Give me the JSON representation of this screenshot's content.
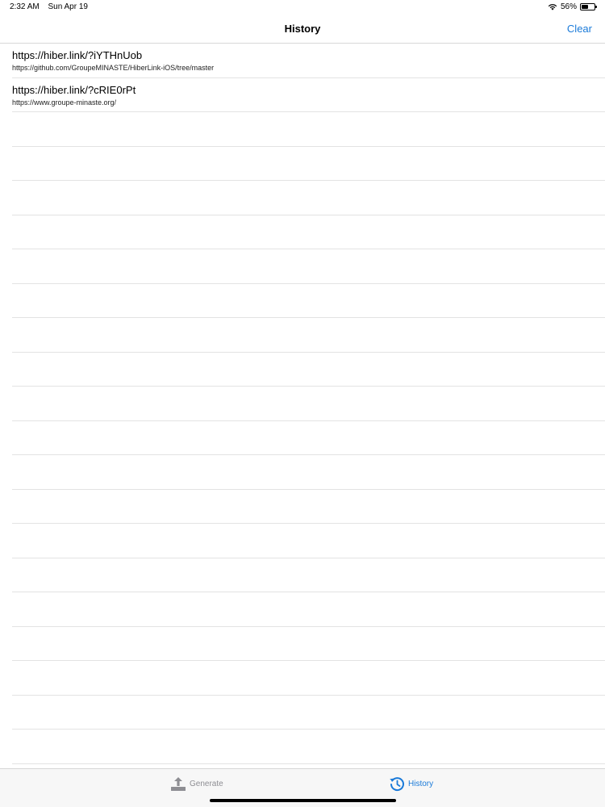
{
  "status_bar": {
    "time": "2:32 AM",
    "date": "Sun Apr 19",
    "battery": "56%",
    "battery_level": 0.56
  },
  "nav": {
    "title": "History",
    "clear_label": "Clear"
  },
  "history": [
    {
      "short_link": "https://hiber.link/?iYTHnUob",
      "target_url": "https://github.com/GroupeMINASTE/HiberLink-iOS/tree/master"
    },
    {
      "short_link": "https://hiber.link/?cRIE0rPt",
      "target_url": "https://www.groupe-minaste.org/"
    }
  ],
  "tab_bar": {
    "generate_label": "Generate",
    "history_label": "History",
    "generate_icon": "upload-icon",
    "history_icon": "history-icon",
    "active_color": "#1a7ad9",
    "inactive_color": "#8e8e93"
  }
}
